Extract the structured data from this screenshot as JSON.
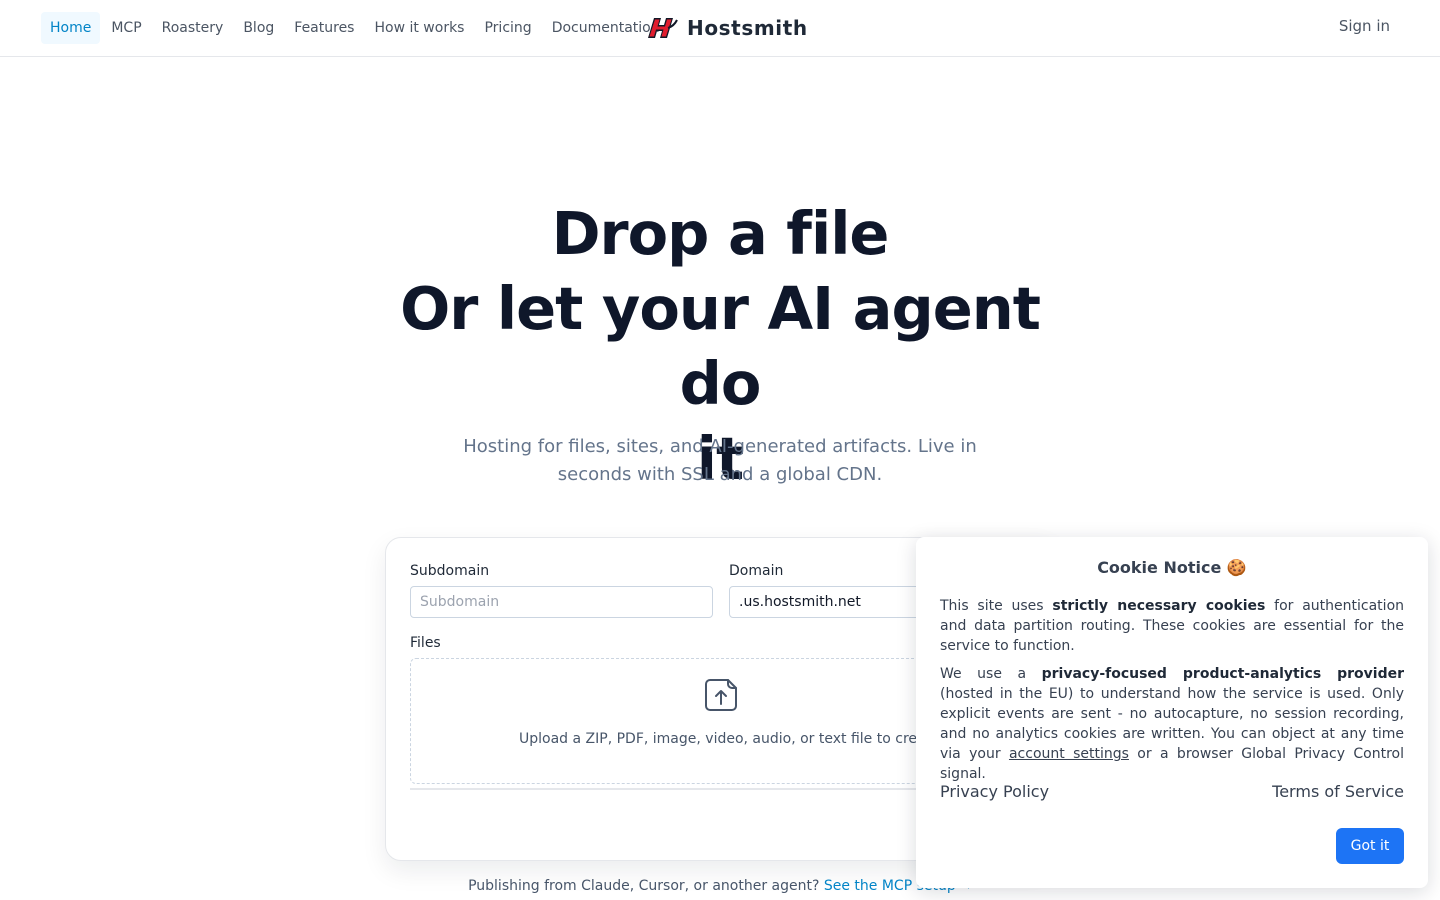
{
  "nav": {
    "items": [
      {
        "label": "Home",
        "active": true
      },
      {
        "label": "MCP"
      },
      {
        "label": "Roastery"
      },
      {
        "label": "Blog"
      },
      {
        "label": "Features"
      },
      {
        "label": "How it works"
      },
      {
        "label": "Pricing"
      },
      {
        "label": "Documentation"
      }
    ],
    "brand": "Hostsmith",
    "logo_icon": "hs-logo-icon",
    "sign_in": "Sign in",
    "active_color": "#0284c7"
  },
  "hero": {
    "title_line1": "Drop a file",
    "title_line2": "Or let your AI agent do",
    "title_line3": "it",
    "subtitle": "Hosting for files, sites, and AI-generated artifacts. Live in seconds with SSL and a global CDN."
  },
  "form": {
    "subdomain_label": "Subdomain",
    "subdomain_placeholder": "Subdomain",
    "domain_label": "Domain",
    "domain_value": ".us.hostsmith.net",
    "files_label": "Files",
    "upload_icon": "file-upload-icon",
    "dropzone_text": "Upload a ZIP, PDF, image, video, audio, or text file to create a site"
  },
  "mcp": {
    "text": "Publishing from Claude, Cursor, or another agent?",
    "link": "See the MCP setup →"
  },
  "cookie": {
    "title": "Cookie Notice 🍪",
    "p1_a": "This site uses ",
    "p1_b": "strictly necessary cookies",
    "p1_c": " for authentication and data partition routing. These cookies are essential for the service to function.",
    "p2_a": "We use a ",
    "p2_b": "privacy-focused product-analytics provider",
    "p2_c": " (hosted in the EU) to understand how the service is used. Only explicit events are sent - no autocapture, no session recording, and no analytics cookies are written. You can object at any time via your ",
    "p2_link": "account settings",
    "p2_d": " or a browser Global Privacy Control signal.",
    "privacy": "Privacy Policy",
    "terms": "Terms of Service",
    "button": "Got it",
    "button_color": "#1d74f5"
  }
}
